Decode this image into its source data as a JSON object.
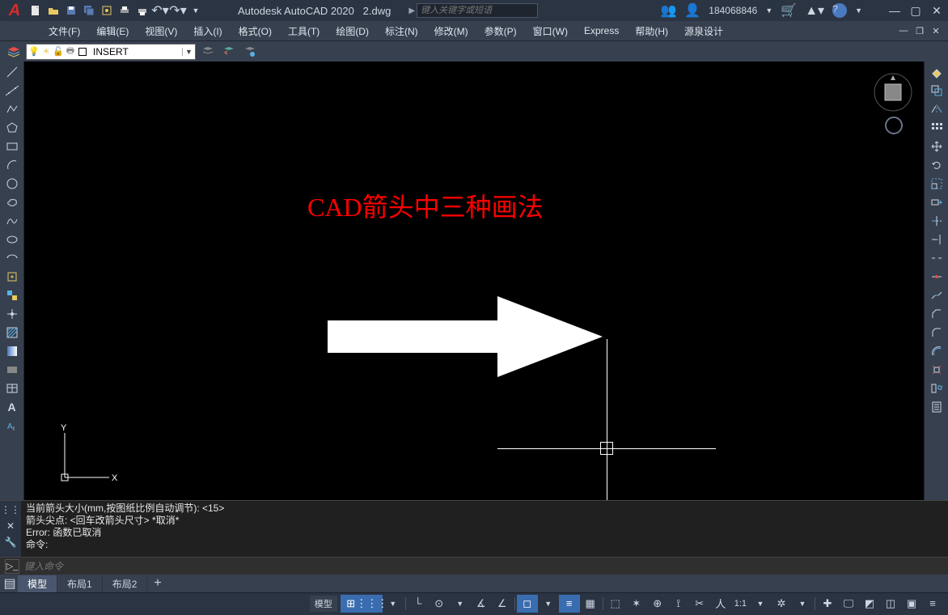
{
  "title": {
    "app": "Autodesk AutoCAD 2020",
    "file": "2.dwg"
  },
  "search": {
    "placeholder": "键入关键字或短语"
  },
  "user": {
    "id": "184068846"
  },
  "menu": {
    "items": [
      "文件(F)",
      "编辑(E)",
      "视图(V)",
      "插入(I)",
      "格式(O)",
      "工具(T)",
      "绘图(D)",
      "标注(N)",
      "修改(M)",
      "参数(P)",
      "窗口(W)",
      "Express",
      "帮助(H)",
      "源泉设计"
    ]
  },
  "layer": {
    "name": "INSERT"
  },
  "canvas": {
    "title_text": "CAD箭头中三种画法"
  },
  "cmdhist": {
    "lines": [
      "当前箭头大小(mm,按图纸比例自动调节): <15>",
      "箭头尖点: <回车改箭头尺寸> *取消*",
      "Error: 函数已取消",
      "命令:"
    ]
  },
  "cmdline": {
    "placeholder": "键入命令"
  },
  "tabs": {
    "items": [
      "模型",
      "布局1",
      "布局2"
    ],
    "active": 0
  },
  "status": {
    "label": "模型",
    "scale": "1:1"
  },
  "icons": {
    "qat": [
      "new",
      "open",
      "save",
      "saveall",
      "plot-preview",
      "plot",
      "print",
      "undo",
      "redo"
    ],
    "title_right": [
      "share",
      "user",
      "cart",
      "appstore",
      "help"
    ],
    "layerbar_left": [
      "layer-props"
    ],
    "layerbar_right": [
      "layer-iso",
      "layer-prev",
      "layer-state"
    ],
    "tools_left": [
      "line",
      "xline",
      "pline",
      "polygon",
      "rectangle",
      "arc",
      "circle",
      "revcloud",
      "spline",
      "ellipse",
      "ellipse-arc",
      "insert",
      "block",
      "hatch",
      "gradient",
      "region",
      "table",
      "text",
      "mtext",
      "point"
    ],
    "tools_right": [
      "erase",
      "copy",
      "mirror",
      "offset",
      "array",
      "move",
      "rotate",
      "scale",
      "stretch",
      "trim",
      "extend",
      "break",
      "join",
      "chamfer",
      "fillet",
      "explode",
      "align",
      "measure",
      "props"
    ]
  }
}
